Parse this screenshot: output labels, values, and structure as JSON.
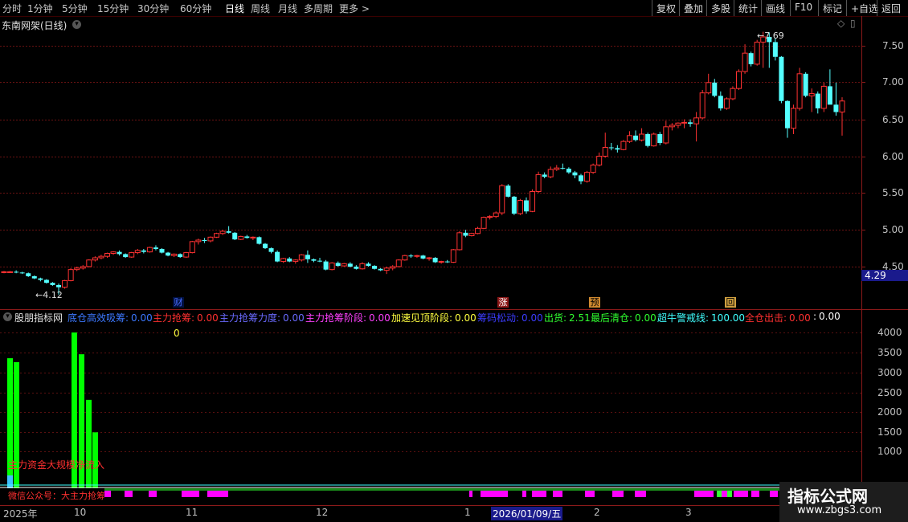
{
  "toolbar": {
    "periods": [
      "分时",
      "1分钟",
      "5分钟",
      "15分钟",
      "30分钟",
      "60分钟",
      "日线",
      "周线",
      "月线",
      "多周期",
      "更多 >"
    ],
    "active_period": "日线",
    "right_buttons": [
      "复权",
      "叠加",
      "多股",
      "统计",
      "画线",
      "F10",
      "标记",
      "+自选",
      "返回"
    ]
  },
  "main_chart": {
    "title": "东南网架(日线)",
    "price_ticks": [
      "7.50",
      "7.00",
      "6.50",
      "6.00",
      "5.50",
      "5.00",
      "4.50"
    ],
    "current_price": "4.29",
    "high_label": "7.69",
    "low_label": "4.12",
    "event_markers": [
      "财",
      "涨",
      "预",
      "回"
    ]
  },
  "indicator": {
    "name": "股朋指标网",
    "items": [
      {
        "label": "底仓高效吸筹:",
        "value": "0.00",
        "color": "#3c78ff"
      },
      {
        "label": "主力抢筹:",
        "value": "0.00",
        "color": "#ff3030"
      },
      {
        "label": "主力抢筹力度:",
        "value": "0.00",
        "color": "#6a6aff"
      },
      {
        "label": "主力抢筹阶段:",
        "value": "0.00",
        "color": "#ff40ff"
      },
      {
        "label": "加速见顶阶段:",
        "value": "0.00",
        "color": "#ffff40"
      },
      {
        "label": "筹码松动:",
        "value": "0.00",
        "color": "#3c3cff"
      },
      {
        "label": "出货:",
        "value": "2.51",
        "color": "#30ff30"
      },
      {
        "label": "最后清仓:",
        "value": "0.00",
        "color": "#30ff30"
      },
      {
        "label": "超牛警戒线:",
        "value": "100.00",
        "color": "#40ffff"
      },
      {
        "label": "全仓出击:",
        "value": "0.00",
        "color": "#ff3030"
      },
      {
        "label": ":",
        "value": "0.00",
        "color": "#ffffff"
      }
    ],
    "zero_label": "0",
    "vol_ticks": [
      "4000",
      "3500",
      "3000",
      "2500",
      "2000",
      "1500",
      "1000"
    ],
    "annotation_1": "主力资金大规模净流入",
    "annotation_2": "微信公众号：大主力抢筹"
  },
  "x_axis": {
    "labels": [
      "2025年",
      "10",
      "11",
      "12",
      "1",
      "2026/01/09/五",
      "2",
      "3"
    ]
  },
  "watermark": {
    "title": "指标公式网",
    "url": "www.zbgs3.com"
  },
  "colors": {
    "up": "#ff3232",
    "down": "#54ffff",
    "grid": "#6a1212",
    "bar_green": "#00ff00",
    "bar_magenta": "#ff00ff"
  },
  "chart_data": {
    "type": "candlestick",
    "ylim": [
      4.05,
      7.8
    ],
    "candles": [
      [
        4.43,
        4.44,
        4.41,
        4.43
      ],
      [
        4.43,
        4.44,
        4.42,
        4.43
      ],
      [
        4.43,
        4.45,
        4.41,
        4.42
      ],
      [
        4.42,
        4.43,
        4.4,
        4.41
      ],
      [
        4.41,
        4.42,
        4.36,
        4.37
      ],
      [
        4.37,
        4.38,
        4.33,
        4.34
      ],
      [
        4.34,
        4.35,
        4.3,
        4.32
      ],
      [
        4.32,
        4.33,
        4.27,
        4.28
      ],
      [
        4.28,
        4.29,
        4.24,
        4.25
      ],
      [
        4.25,
        4.27,
        4.12,
        4.22
      ],
      [
        4.22,
        4.32,
        4.2,
        4.31
      ],
      [
        4.31,
        4.48,
        4.3,
        4.46
      ],
      [
        4.46,
        4.5,
        4.44,
        4.48
      ],
      [
        4.48,
        4.52,
        4.46,
        4.5
      ],
      [
        4.5,
        4.6,
        4.49,
        4.59
      ],
      [
        4.59,
        4.64,
        4.57,
        4.62
      ],
      [
        4.62,
        4.66,
        4.6,
        4.64
      ],
      [
        4.64,
        4.69,
        4.62,
        4.68
      ],
      [
        4.68,
        4.71,
        4.66,
        4.7
      ],
      [
        4.7,
        4.72,
        4.65,
        4.67
      ],
      [
        4.67,
        4.68,
        4.62,
        4.63
      ],
      [
        4.63,
        4.7,
        4.62,
        4.69
      ],
      [
        4.69,
        4.74,
        4.67,
        4.72
      ],
      [
        4.72,
        4.74,
        4.68,
        4.7
      ],
      [
        4.7,
        4.77,
        4.69,
        4.76
      ],
      [
        4.76,
        4.79,
        4.72,
        4.74
      ],
      [
        4.74,
        4.75,
        4.68,
        4.69
      ],
      [
        4.69,
        4.7,
        4.64,
        4.65
      ],
      [
        4.65,
        4.68,
        4.63,
        4.67
      ],
      [
        4.67,
        4.68,
        4.62,
        4.63
      ],
      [
        4.63,
        4.7,
        4.62,
        4.69
      ],
      [
        4.69,
        4.85,
        4.68,
        4.84
      ],
      [
        4.84,
        4.88,
        4.8,
        4.86
      ],
      [
        4.86,
        4.89,
        4.82,
        4.85
      ],
      [
        4.85,
        4.91,
        4.83,
        4.9
      ],
      [
        4.9,
        4.96,
        4.89,
        4.95
      ],
      [
        4.95,
        5.0,
        4.93,
        4.98
      ],
      [
        4.98,
        5.05,
        4.95,
        4.96
      ],
      [
        4.96,
        4.97,
        4.86,
        4.87
      ],
      [
        4.87,
        4.92,
        4.86,
        4.91
      ],
      [
        4.91,
        4.93,
        4.88,
        4.89
      ],
      [
        4.89,
        4.91,
        4.86,
        4.9
      ],
      [
        4.9,
        4.91,
        4.8,
        4.81
      ],
      [
        4.81,
        4.82,
        4.74,
        4.75
      ],
      [
        4.75,
        4.76,
        4.68,
        4.7
      ],
      [
        4.7,
        4.72,
        4.56,
        4.57
      ],
      [
        4.57,
        4.62,
        4.55,
        4.61
      ],
      [
        4.61,
        4.63,
        4.56,
        4.57
      ],
      [
        4.57,
        4.6,
        4.54,
        4.59
      ],
      [
        4.59,
        4.67,
        4.57,
        4.66
      ],
      [
        4.66,
        4.72,
        4.55,
        4.6
      ],
      [
        4.6,
        4.61,
        4.56,
        4.58
      ],
      [
        4.58,
        4.62,
        4.56,
        4.57
      ],
      [
        4.57,
        4.59,
        4.45,
        4.46
      ],
      [
        4.46,
        4.56,
        4.45,
        4.55
      ],
      [
        4.55,
        4.57,
        4.5,
        4.51
      ],
      [
        4.51,
        4.55,
        4.5,
        4.54
      ],
      [
        4.54,
        4.56,
        4.49,
        4.5
      ],
      [
        4.5,
        4.52,
        4.46,
        4.47
      ],
      [
        4.47,
        4.56,
        4.46,
        4.54
      ],
      [
        4.54,
        4.56,
        4.5,
        4.51
      ],
      [
        4.51,
        4.52,
        4.46,
        4.47
      ],
      [
        4.47,
        4.48,
        4.44,
        4.45
      ],
      [
        4.45,
        4.5,
        4.4,
        4.48
      ],
      [
        4.48,
        4.52,
        4.45,
        4.5
      ],
      [
        4.5,
        4.6,
        4.49,
        4.59
      ],
      [
        4.59,
        4.66,
        4.58,
        4.65
      ],
      [
        4.65,
        4.67,
        4.62,
        4.64
      ],
      [
        4.64,
        4.66,
        4.62,
        4.65
      ],
      [
        4.65,
        4.66,
        4.6,
        4.61
      ],
      [
        4.61,
        4.63,
        4.58,
        4.62
      ],
      [
        4.62,
        4.63,
        4.55,
        4.56
      ],
      [
        4.56,
        4.58,
        4.54,
        4.57
      ],
      [
        4.57,
        4.59,
        4.55,
        4.56
      ],
      [
        4.56,
        4.74,
        4.55,
        4.73
      ],
      [
        4.73,
        4.98,
        4.72,
        4.96
      ],
      [
        4.96,
        5.0,
        4.9,
        4.92
      ],
      [
        4.92,
        4.96,
        4.91,
        4.95
      ],
      [
        4.95,
        5.04,
        4.94,
        5.02
      ],
      [
        5.02,
        5.18,
        5.01,
        5.17
      ],
      [
        5.17,
        5.2,
        5.14,
        5.18
      ],
      [
        5.18,
        5.25,
        5.16,
        5.23
      ],
      [
        5.23,
        5.62,
        5.2,
        5.6
      ],
      [
        5.6,
        5.62,
        5.44,
        5.45
      ],
      [
        5.45,
        5.46,
        5.2,
        5.22
      ],
      [
        5.22,
        5.42,
        5.2,
        5.4
      ],
      [
        5.4,
        5.44,
        5.22,
        5.25
      ],
      [
        5.25,
        5.55,
        5.24,
        5.52
      ],
      [
        5.52,
        5.79,
        5.5,
        5.75
      ],
      [
        5.75,
        5.78,
        5.7,
        5.72
      ],
      [
        5.72,
        5.86,
        5.7,
        5.82
      ],
      [
        5.82,
        5.88,
        5.8,
        5.84
      ],
      [
        5.84,
        5.9,
        5.82,
        5.83
      ],
      [
        5.83,
        5.85,
        5.76,
        5.78
      ],
      [
        5.78,
        5.8,
        5.7,
        5.74
      ],
      [
        5.74,
        5.76,
        5.62,
        5.66
      ],
      [
        5.66,
        5.8,
        5.64,
        5.78
      ],
      [
        5.78,
        5.9,
        5.76,
        5.88
      ],
      [
        5.88,
        6.05,
        5.86,
        6.0
      ],
      [
        6.0,
        6.32,
        5.98,
        6.12
      ],
      [
        6.12,
        6.18,
        6.08,
        6.11
      ],
      [
        6.11,
        6.15,
        6.05,
        6.09
      ],
      [
        6.09,
        6.22,
        6.08,
        6.2
      ],
      [
        6.2,
        6.34,
        6.18,
        6.28
      ],
      [
        6.28,
        6.35,
        6.2,
        6.22
      ],
      [
        6.22,
        6.38,
        6.2,
        6.3
      ],
      [
        6.3,
        6.32,
        6.12,
        6.14
      ],
      [
        6.14,
        6.32,
        6.13,
        6.3
      ],
      [
        6.3,
        6.33,
        6.15,
        6.18
      ],
      [
        6.18,
        6.48,
        6.16,
        6.4
      ],
      [
        6.4,
        6.45,
        6.35,
        6.42
      ],
      [
        6.42,
        6.46,
        6.38,
        6.45
      ],
      [
        6.45,
        6.5,
        6.38,
        6.46
      ],
      [
        6.46,
        6.5,
        6.4,
        6.44
      ],
      [
        6.44,
        6.6,
        6.2,
        6.52
      ],
      [
        6.52,
        6.9,
        6.5,
        6.86
      ],
      [
        6.86,
        7.12,
        6.84,
        7.0
      ],
      [
        7.0,
        7.05,
        6.8,
        6.82
      ],
      [
        6.82,
        6.88,
        6.62,
        6.65
      ],
      [
        6.65,
        6.8,
        6.63,
        6.78
      ],
      [
        6.78,
        6.95,
        6.76,
        6.92
      ],
      [
        6.92,
        7.18,
        6.9,
        7.15
      ],
      [
        7.15,
        7.52,
        7.12,
        7.4
      ],
      [
        7.4,
        7.42,
        7.22,
        7.25
      ],
      [
        7.25,
        7.58,
        7.23,
        7.55
      ],
      [
        7.55,
        7.69,
        7.2,
        7.62
      ],
      [
        7.62,
        7.68,
        7.2,
        7.55
      ],
      [
        7.55,
        7.6,
        7.3,
        7.35
      ],
      [
        7.35,
        7.36,
        6.72,
        6.75
      ],
      [
        6.75,
        6.76,
        6.25,
        6.38
      ],
      [
        6.38,
        6.7,
        6.3,
        6.65
      ],
      [
        6.65,
        7.2,
        6.62,
        7.12
      ],
      [
        7.12,
        7.14,
        6.8,
        6.82
      ],
      [
        6.82,
        6.92,
        6.6,
        6.85
      ],
      [
        6.85,
        6.88,
        6.58,
        6.65
      ],
      [
        6.65,
        7.0,
        6.6,
        6.95
      ],
      [
        6.95,
        7.18,
        6.9,
        6.7
      ],
      [
        6.7,
        7.0,
        6.55,
        6.6
      ],
      [
        6.6,
        6.8,
        6.28,
        6.75
      ]
    ],
    "volume_bars": [
      {
        "x": 0,
        "value": 3350
      },
      {
        "x": 1,
        "value": 3250
      },
      {
        "x": 14,
        "value": 4000
      },
      {
        "x": 15,
        "value": 3450
      },
      {
        "x": 16,
        "value": 2300
      },
      {
        "x": 17,
        "value": 1480
      }
    ]
  }
}
